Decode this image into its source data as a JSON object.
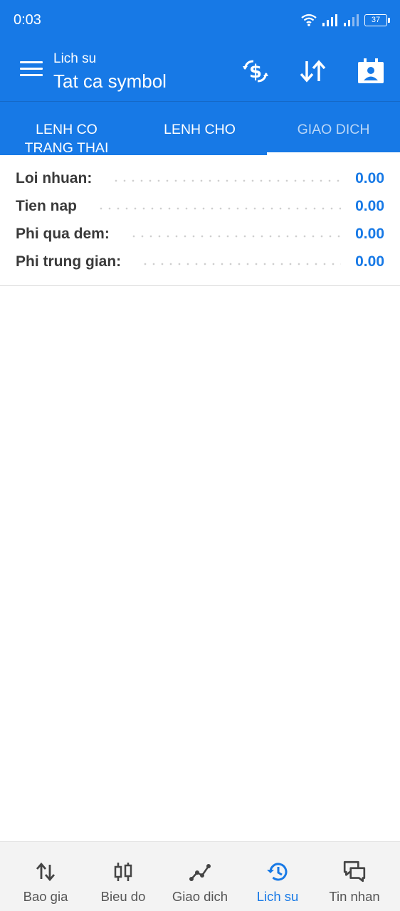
{
  "status_bar": {
    "time": "0:03",
    "battery": "37"
  },
  "app_bar": {
    "subtitle": "Lich su",
    "title": "Tat ca symbol",
    "actions": [
      "currency-exchange-icon",
      "sort-icon",
      "contact-calendar-icon"
    ]
  },
  "tabs": [
    {
      "label": "LENH CO TRANG THAI"
    },
    {
      "label": "LENH CHO"
    },
    {
      "label": "GIAO DICH",
      "selected": true
    }
  ],
  "summary": [
    {
      "label": "Loi nhuan:",
      "value": "0.00"
    },
    {
      "label": "Tien nap",
      "value": "0.00"
    },
    {
      "label": "Phi qua dem:",
      "value": "0.00"
    },
    {
      "label": "Phi trung gian:",
      "value": "0.00"
    }
  ],
  "bottom_nav": [
    {
      "label": "Bao gia",
      "icon": "quotes-icon"
    },
    {
      "label": "Bieu do",
      "icon": "candlestick-icon"
    },
    {
      "label": "Giao dich",
      "icon": "trade-icon"
    },
    {
      "label": "Lich su",
      "icon": "history-icon",
      "active": true
    },
    {
      "label": "Tin nhan",
      "icon": "messages-icon"
    }
  ],
  "colors": {
    "primary": "#1779e6",
    "active": "#1779e6",
    "value": "#1779e6"
  }
}
